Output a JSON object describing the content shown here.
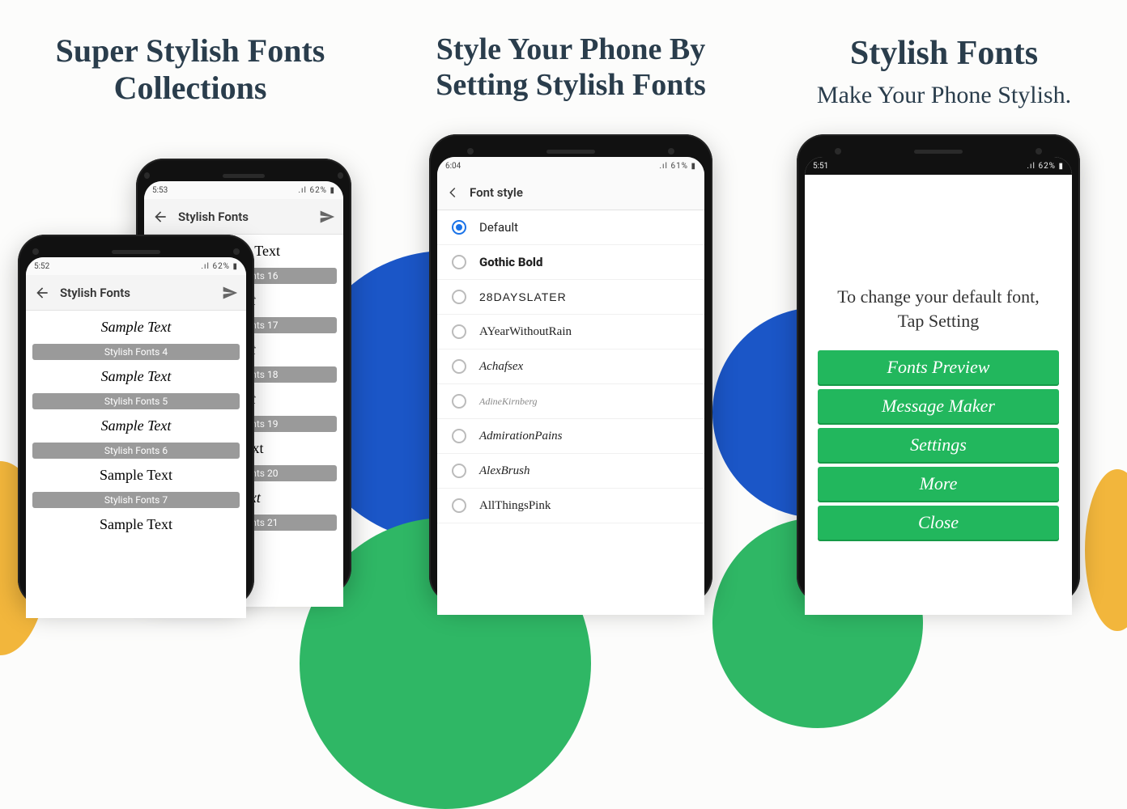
{
  "headlines": {
    "p1l1": "Super Stylish Fonts",
    "p1l2": "Collections",
    "p2l1": "Style Your Phone By",
    "p2l2": "Setting Stylish Fonts",
    "p3l1": "Stylish Fonts",
    "p3l2": "Make Your Phone Stylish."
  },
  "phone_back": {
    "time": "5:53",
    "signal": ".ıl 62% ▮",
    "title": "Stylish Fonts",
    "items": [
      {
        "sample": "Sample Text",
        "label": "Stylish Fonts 16",
        "cls": "black"
      },
      {
        "sample": "Text",
        "label": "Stylish Fonts 17",
        "cls": "cursive"
      },
      {
        "sample": "Text",
        "label": "Stylish Fonts 18",
        "cls": "cursive"
      },
      {
        "sample": "Text",
        "label": "Stylish Fonts 19",
        "cls": "cursive"
      },
      {
        "sample": "le Text",
        "label": "Stylish Fonts 20",
        "cls": "hand"
      },
      {
        "sample": "e Text",
        "label": "Stylish Fonts 21",
        "cls": "cursive"
      }
    ]
  },
  "phone_front": {
    "time": "5:52",
    "signal": ".ıl 62% ▮",
    "title": "Stylish Fonts",
    "items": [
      {
        "sample": "Sample Text",
        "label": "Stylish Fonts 4",
        "cls": "cursive"
      },
      {
        "sample": "Sample Text",
        "label": "Stylish Fonts 5",
        "cls": "cursive"
      },
      {
        "sample": "Sample Text",
        "label": "Stylish Fonts 6",
        "cls": "cursive"
      },
      {
        "sample": "Sample Text",
        "label": "Stylish Fonts 7",
        "cls": "hand"
      },
      {
        "sample": "Sample Text",
        "label": "",
        "cls": "hand"
      }
    ]
  },
  "phone_mid": {
    "time": "6:04",
    "signal": ".ıl 61% ▮",
    "title": "Font style",
    "options": [
      {
        "label": "Default",
        "selected": true,
        "cls": ""
      },
      {
        "label": "Gothic Bold",
        "selected": false,
        "cls": "bold"
      },
      {
        "label": "28DaysLater",
        "selected": false,
        "cls": "stencil"
      },
      {
        "label": "AYearWithoutRain",
        "selected": false,
        "cls": "hand"
      },
      {
        "label": "Achafsex",
        "selected": false,
        "cls": "fancy"
      },
      {
        "label": "AdineKirnberg",
        "selected": false,
        "cls": "script-sm"
      },
      {
        "label": "AdmirationPains",
        "selected": false,
        "cls": "script"
      },
      {
        "label": "AlexBrush",
        "selected": false,
        "cls": "script"
      },
      {
        "label": "AllThingsPink",
        "selected": false,
        "cls": "hand"
      }
    ]
  },
  "phone_right": {
    "time": "5:51",
    "signal": ".ıl 62% ▮",
    "instruction_l1": "To change your default font,",
    "instruction_l2": "Tap Setting",
    "buttons": [
      "Fonts Preview",
      "Message Maker",
      "Settings",
      "More",
      "Close"
    ]
  }
}
